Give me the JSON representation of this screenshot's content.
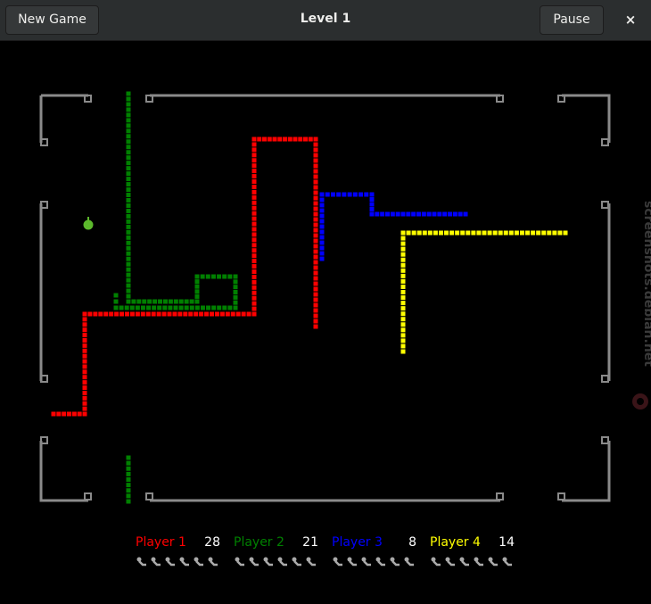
{
  "header": {
    "title": "Level 1",
    "new_game_label": "New Game",
    "pause_label": "Pause",
    "close_glyph": "×"
  },
  "colors": {
    "background": "#000000",
    "wall": "#8a8a8a",
    "apple": "#5cb82c"
  },
  "players": [
    {
      "name": "Player 1",
      "score": "28",
      "color": "#ff0000",
      "lives": 6
    },
    {
      "name": "Player 2",
      "score": "21",
      "color": "#008000",
      "lives": 6
    },
    {
      "name": "Player 3",
      "score": "8",
      "color": "#0000ff",
      "lives": 6
    },
    {
      "name": "Player 4",
      "score": "14",
      "color": "#ffff00",
      "lives": 6
    }
  ],
  "watermark": "screenshots.debian.net"
}
